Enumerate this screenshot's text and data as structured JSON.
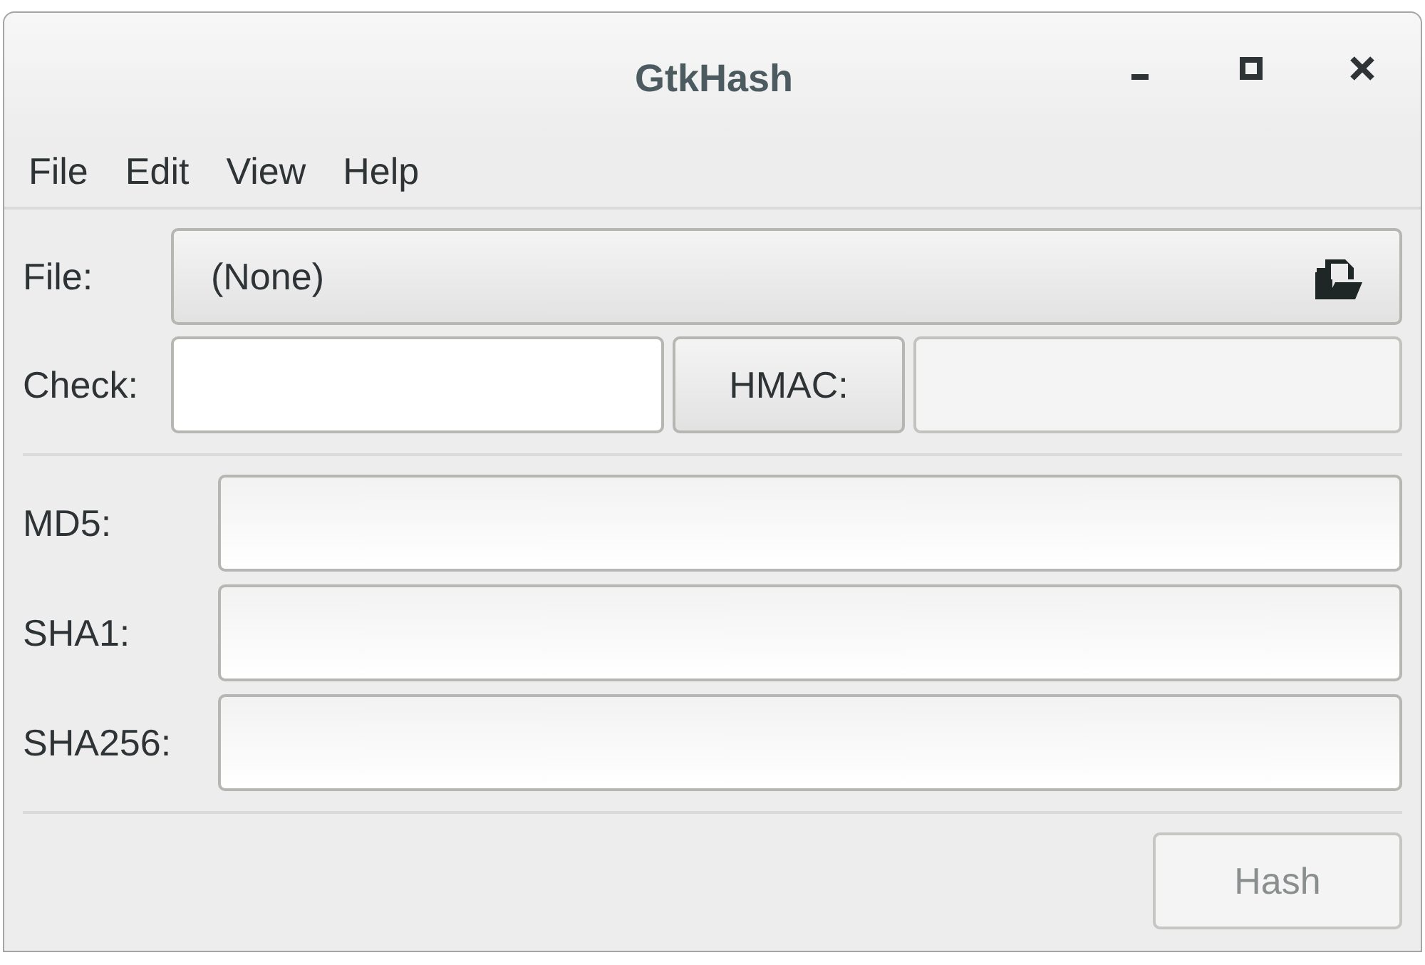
{
  "window": {
    "title": "GtkHash"
  },
  "menu": [
    "File",
    "Edit",
    "View",
    "Help"
  ],
  "file": {
    "label": "File:",
    "value": "(None)"
  },
  "check": {
    "label": "Check:",
    "hmac_button": "HMAC:",
    "hmac_enabled": false
  },
  "hashes": [
    {
      "label": "MD5:"
    },
    {
      "label": "SHA1:"
    },
    {
      "label": "SHA256:"
    }
  ],
  "hash_button": {
    "label": "Hash",
    "disabled": true
  }
}
